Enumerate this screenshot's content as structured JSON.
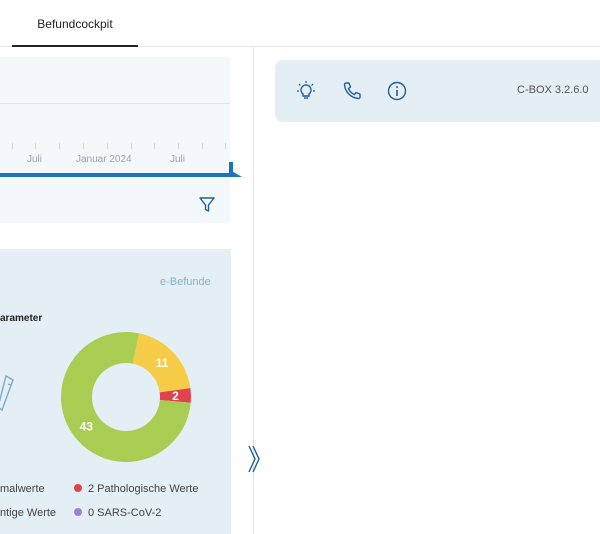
{
  "tabs": [
    {
      "label": "Befundcockpit",
      "active": true
    }
  ],
  "timeline": {
    "tick_labels": [
      "Juli",
      "Januar 2024",
      "Juli"
    ]
  },
  "results": {
    "link": "e-Befunde",
    "title": "arameter",
    "donut": [
      {
        "value": 11,
        "color": "#f6cb47"
      },
      {
        "value": 2,
        "color": "#e0434e"
      },
      {
        "value": 43,
        "color": "#a9cd52"
      }
    ],
    "legend": [
      {
        "label": "malwerte",
        "color": "#a9cd52"
      },
      {
        "label": "2 Pathologische Werte",
        "color": "#e0434e"
      },
      {
        "label": "ntige Werte",
        "color": "#f6cb47"
      },
      {
        "label": "0 SARS-CoV-2",
        "color": "#a07ed0"
      }
    ]
  },
  "infobar": {
    "version": "C-BOX 3.2.6.0",
    "icons": [
      "lightbulb-icon",
      "phone-icon",
      "info-icon"
    ]
  },
  "colors": {
    "accent": "#1a76b9",
    "icon": "#1f5f9a"
  }
}
